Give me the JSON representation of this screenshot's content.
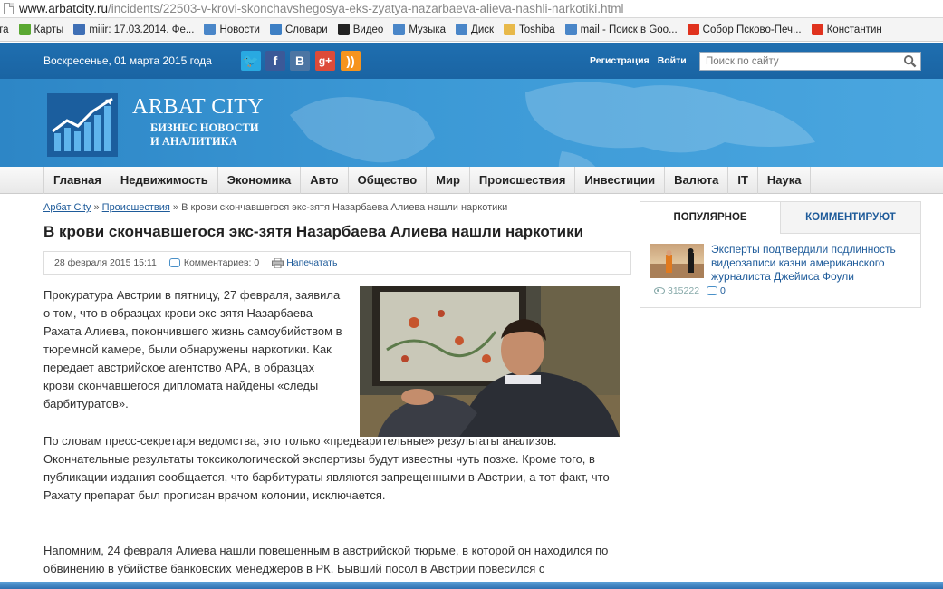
{
  "browser": {
    "url_host": "www.arbatcity.ru",
    "url_path": "/incidents/22503-v-krovi-skonchavshegosya-eks-zyatya-nazarbaeva-alieva-nashli-narkotiki.html",
    "bookmarks": [
      {
        "label": "чта",
        "color": ""
      },
      {
        "label": "Карты",
        "color": "#5aa832"
      },
      {
        "label": "miiir: 17.03.2014. Фе...",
        "color": "#3f6fb5"
      },
      {
        "label": "Новости",
        "color": "#4a86c8"
      },
      {
        "label": "Словари",
        "color": "#3d7fc4"
      },
      {
        "label": "Видео",
        "color": "#222222"
      },
      {
        "label": "Музыка",
        "color": "#4a86c8"
      },
      {
        "label": "Диск",
        "color": "#4a86c8"
      },
      {
        "label": "Toshiba",
        "color": "#e8b94a"
      },
      {
        "label": "mail - Поиск в Goo...",
        "color": "#4a86c8"
      },
      {
        "label": "Собор Псково-Печ...",
        "color": "#e0321e"
      },
      {
        "label": "Константин",
        "color": "#e0321e"
      }
    ]
  },
  "header": {
    "date": "Воскресенье, 01 марта 2015 года",
    "social": {
      "twitter": "🐦",
      "facebook": "f",
      "vk": "B",
      "gplus": "g+",
      "rss": "))"
    },
    "register": "Регистрация",
    "login": "Войти",
    "search_placeholder": "Поиск по сайту",
    "logo_title": "ARBAT CITY",
    "logo_sub1": "БИЗНЕС НОВОСТИ",
    "logo_sub2": "И АНАЛИТИКА"
  },
  "nav": [
    "Главная",
    "Недвижимость",
    "Экономика",
    "Авто",
    "Общество",
    "Мир",
    "Происшествия",
    "Инвестиции",
    "Валюта",
    "IT",
    "Наука"
  ],
  "article": {
    "crumb_home": "Арбат City",
    "crumb_sep": " » ",
    "crumb_section": "Происшествия",
    "crumb_current": "В крови скончавшегося экс-зятя Назарбаева Алиева нашли наркотики",
    "title": "В крови скончавшегося экс-зятя Назарбаева Алиева нашли наркотики",
    "date": "28 февраля 2015 15:11",
    "comments": "Комментариев: 0",
    "print": "Напечатать",
    "p1": "Прокуратура Австрии в пятницу, 27 февраля, заявила о том, что в образцах крови экс-зятя Назарбаева Рахата Алиева, покончившего жизнь самоубийством в тюремной камере, были обнаружены наркотики. Как передает австрийское агентство APA, в образцах крови скончавшегося дипломата найдены «следы барбитуратов».",
    "p2": "По словам пресс-секретаря ведомства, это только «предварительные» результаты анализов. Окончательные результаты токсикологической экспертизы будут известны чуть позже. Кроме того, в публикации издания сообщается, что барбитураты являются запрещенными в Австрии, а тот факт, что Рахату препарат был прописан врачом колонии, исключается.",
    "p3": "Напомним, 24 февраля Алиева нашли повешенным в австрийской тюрьме, в которой он находился по обвинению в убийстве банковских менеджеров в РК. Бывший посол в Австрии повесился с"
  },
  "sidebar": {
    "tab_popular": "ПОПУЛЯРНОЕ",
    "tab_commented": "КОММЕНТИРУЮТ",
    "item_title": "Эксперты подтвердили подлинность видеозаписи казни американского журналиста Джеймса Фоули",
    "item_views": "315222",
    "item_comments": "0"
  }
}
